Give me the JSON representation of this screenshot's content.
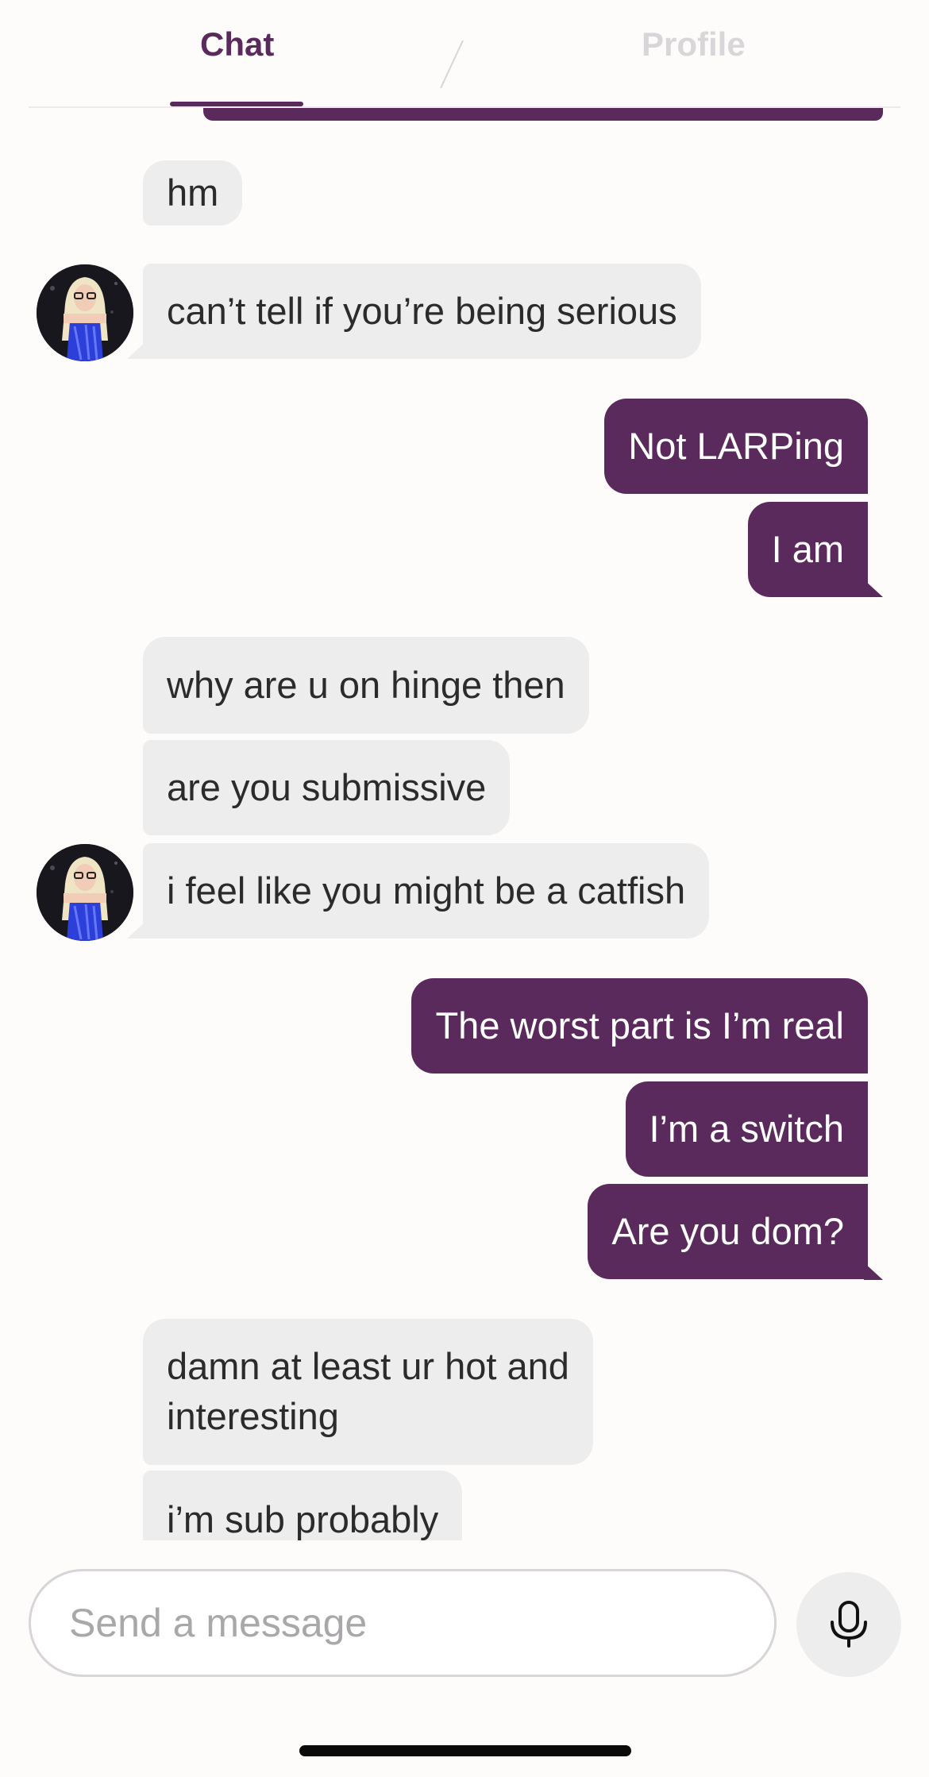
{
  "tabs": {
    "chat": "Chat",
    "profile": "Profile"
  },
  "messages": [
    {
      "side": "in",
      "text": "hm"
    },
    {
      "side": "in",
      "text": "can’t tell if you’re being serious"
    },
    {
      "side": "out",
      "text": "Not LARPing"
    },
    {
      "side": "out",
      "text": "I am"
    },
    {
      "side": "in",
      "text": "why are u on hinge then"
    },
    {
      "side": "in",
      "text": "are you submissive"
    },
    {
      "side": "in",
      "text": "i feel like you might be a catfish"
    },
    {
      "side": "out",
      "text": "The worst part is I’m real"
    },
    {
      "side": "out",
      "text": "I’m a switch"
    },
    {
      "side": "out",
      "text": "Are you dom?"
    },
    {
      "side": "in",
      "text": "damn at least ur hot and interesting",
      "lines": [
        "damn at least ur hot and",
        "interesting"
      ]
    },
    {
      "side": "in",
      "text": "i’m sub probably"
    }
  ],
  "composer": {
    "placeholder": "Send a message",
    "value": "",
    "mic_icon": "microphone-icon"
  },
  "colors": {
    "accent": "#5B2A5D",
    "incoming_bubble": "#EEEDEE",
    "inactive_tab": "#D9D6D9"
  }
}
